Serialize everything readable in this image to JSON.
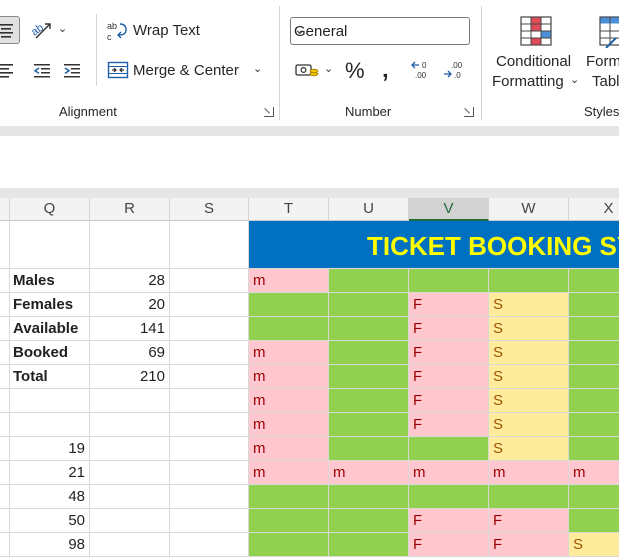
{
  "ribbon": {
    "alignment": {
      "wrap_text": "Wrap Text",
      "merge_center": "Merge & Center",
      "label": "Alignment"
    },
    "number": {
      "format_value": "General",
      "currency_symbol": "%",
      "comma_symbol": "‚",
      "label": "Number"
    },
    "styles": {
      "conditional_line1": "Conditional",
      "conditional_line2": "Formatting",
      "format_table_line1": "Form",
      "format_table_line2": "Tabl",
      "label": "Styles"
    }
  },
  "columns": [
    "Q",
    "R",
    "S",
    "T",
    "U",
    "V",
    "W",
    "X"
  ],
  "selected_column": "V",
  "title": "TICKET BOOKING SYS",
  "summary": [
    {
      "label": "Males",
      "value": "28"
    },
    {
      "label": "Females",
      "value": "20"
    },
    {
      "label": "Available",
      "value": "141"
    },
    {
      "label": "Booked",
      "value": "69"
    },
    {
      "label": "Total",
      "value": "210"
    }
  ],
  "q_values": [
    "19",
    "21",
    "48",
    "50",
    "98"
  ],
  "seat_rows": [
    [
      {
        "c": "pink",
        "t": "m"
      },
      {
        "c": "green",
        "t": ""
      },
      {
        "c": "green",
        "t": ""
      },
      {
        "c": "green",
        "t": ""
      },
      {
        "c": "green",
        "t": ""
      }
    ],
    [
      {
        "c": "green",
        "t": ""
      },
      {
        "c": "green",
        "t": ""
      },
      {
        "c": "pink",
        "t": "F"
      },
      {
        "c": "yellow",
        "t": "S"
      },
      {
        "c": "green",
        "t": ""
      }
    ],
    [
      {
        "c": "green",
        "t": ""
      },
      {
        "c": "green",
        "t": ""
      },
      {
        "c": "pink",
        "t": "F"
      },
      {
        "c": "yellow",
        "t": "S"
      },
      {
        "c": "green",
        "t": ""
      }
    ],
    [
      {
        "c": "pink",
        "t": "m"
      },
      {
        "c": "green",
        "t": ""
      },
      {
        "c": "pink",
        "t": "F"
      },
      {
        "c": "yellow",
        "t": "S"
      },
      {
        "c": "green",
        "t": ""
      }
    ],
    [
      {
        "c": "pink",
        "t": "m"
      },
      {
        "c": "green",
        "t": ""
      },
      {
        "c": "pink",
        "t": "F"
      },
      {
        "c": "yellow",
        "t": "S"
      },
      {
        "c": "green",
        "t": ""
      }
    ],
    [
      {
        "c": "pink",
        "t": "m"
      },
      {
        "c": "green",
        "t": ""
      },
      {
        "c": "pink",
        "t": "F"
      },
      {
        "c": "yellow",
        "t": "S"
      },
      {
        "c": "green",
        "t": ""
      }
    ],
    [
      {
        "c": "pink",
        "t": "m"
      },
      {
        "c": "green",
        "t": ""
      },
      {
        "c": "pink",
        "t": "F"
      },
      {
        "c": "yellow",
        "t": "S"
      },
      {
        "c": "green",
        "t": ""
      }
    ],
    [
      {
        "c": "pink",
        "t": "m"
      },
      {
        "c": "green",
        "t": ""
      },
      {
        "c": "green",
        "t": ""
      },
      {
        "c": "yellow",
        "t": "S"
      },
      {
        "c": "green",
        "t": ""
      }
    ],
    [
      {
        "c": "pink",
        "t": "m"
      },
      {
        "c": "pink",
        "t": "m"
      },
      {
        "c": "pink",
        "t": "m"
      },
      {
        "c": "pink",
        "t": "m"
      },
      {
        "c": "pink",
        "t": "m"
      }
    ],
    [
      {
        "c": "green",
        "t": ""
      },
      {
        "c": "green",
        "t": ""
      },
      {
        "c": "green",
        "t": ""
      },
      {
        "c": "green",
        "t": ""
      },
      {
        "c": "green",
        "t": ""
      }
    ],
    [
      {
        "c": "green",
        "t": ""
      },
      {
        "c": "green",
        "t": ""
      },
      {
        "c": "pink",
        "t": "F"
      },
      {
        "c": "pink",
        "t": "F"
      },
      {
        "c": "green",
        "t": ""
      }
    ],
    [
      {
        "c": "green",
        "t": ""
      },
      {
        "c": "green",
        "t": ""
      },
      {
        "c": "pink",
        "t": "F"
      },
      {
        "c": "pink",
        "t": "F"
      },
      {
        "c": "yellow",
        "t": "S"
      }
    ]
  ],
  "colors": {
    "title_bg": "#0070c0",
    "title_text": "#ffff00",
    "available_green": "#92d050",
    "booked_pink": "#ffc7ce",
    "special_yellow": "#ffeb9c"
  }
}
